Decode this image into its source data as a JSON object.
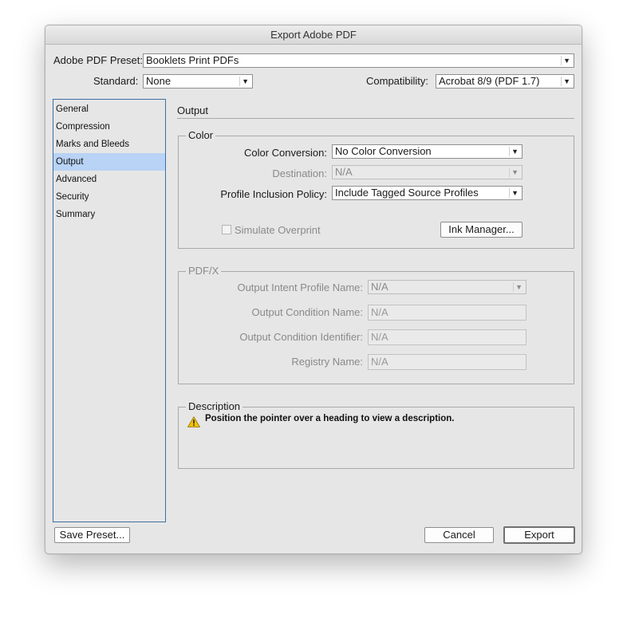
{
  "window": {
    "title": "Export Adobe PDF"
  },
  "preset": {
    "label": "Adobe PDF Preset:",
    "value": "Booklets Print PDFs"
  },
  "standard": {
    "label": "Standard:",
    "value": "None"
  },
  "compatibility": {
    "label": "Compatibility:",
    "value": "Acrobat 8/9 (PDF 1.7)"
  },
  "sidebar": {
    "items": [
      {
        "label": "General",
        "selected": false
      },
      {
        "label": "Compression",
        "selected": false
      },
      {
        "label": "Marks and Bleeds",
        "selected": false
      },
      {
        "label": "Output",
        "selected": true
      },
      {
        "label": "Advanced",
        "selected": false
      },
      {
        "label": "Security",
        "selected": false
      },
      {
        "label": "Summary",
        "selected": false
      }
    ]
  },
  "main": {
    "title": "Output",
    "color_group": {
      "legend": "Color",
      "conversion_label": "Color Conversion:",
      "conversion_value": "No Color Conversion",
      "destination_label": "Destination:",
      "destination_value": "N/A",
      "policy_label": "Profile Inclusion Policy:",
      "policy_value": "Include Tagged Source Profiles",
      "simulate_label": "Simulate Overprint",
      "ink_manager_label": "Ink Manager..."
    },
    "pdfx_group": {
      "legend": "PDF/X",
      "intent_label": "Output Intent Profile Name:",
      "intent_value": "N/A",
      "condition_name_label": "Output Condition Name:",
      "condition_name_value": "N/A",
      "condition_id_label": "Output Condition Identifier:",
      "condition_id_value": "N/A",
      "registry_label": "Registry Name:",
      "registry_value": "N/A"
    },
    "description_group": {
      "legend": "Description",
      "text": "Position the pointer over a heading to view a description."
    }
  },
  "footer": {
    "save_preset_label": "Save Preset...",
    "cancel_label": "Cancel",
    "export_label": "Export"
  },
  "colors": {
    "selection": "#b8d3f5",
    "sidebar_border": "#3c6fa3",
    "window_bg": "#e6e6e6",
    "warning": "#f2c200"
  }
}
